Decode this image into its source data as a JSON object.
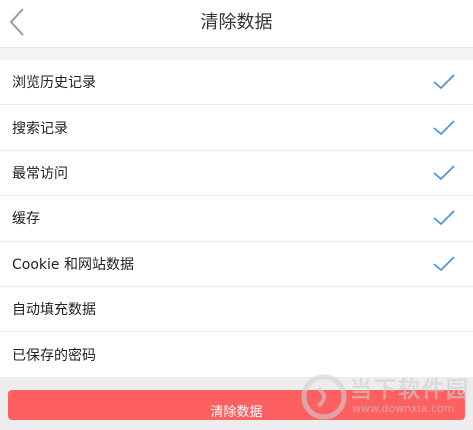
{
  "header": {
    "title": "清除数据",
    "back_icon": "chevron-left-icon"
  },
  "items": [
    {
      "label": "浏览历史记录",
      "checked": true
    },
    {
      "label": "搜索记录",
      "checked": true
    },
    {
      "label": "最常访问",
      "checked": true
    },
    {
      "label": "缓存",
      "checked": true
    },
    {
      "label": "Cookie 和网站数据",
      "checked": true
    },
    {
      "label": "自动填充数据",
      "checked": false
    },
    {
      "label": "已保存的密码",
      "checked": false
    }
  ],
  "clear_button": {
    "label": "清除数据"
  },
  "watermark": {
    "text": "当下软件园",
    "url": "www.downxia.com"
  },
  "colors": {
    "accent": "#4a90d9",
    "button": "#fd6060",
    "background": "#f4f4f4"
  }
}
